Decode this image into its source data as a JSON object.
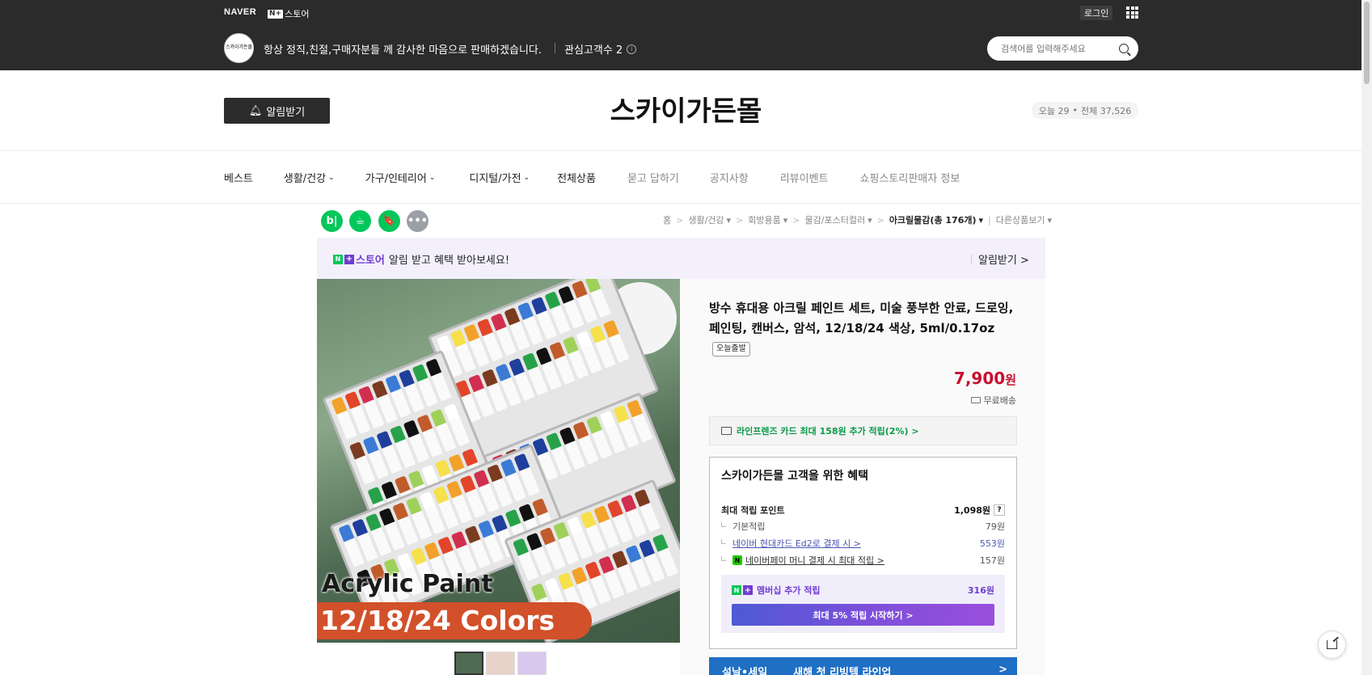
{
  "topbar": {
    "naver_logo": "NAVER",
    "nplus_box": "N+",
    "nplus_store": "스토어",
    "login": "로그인",
    "store_avatar_text": "스카이가든몰",
    "store_description": "항상 정직,친절,구매자분들 께 감사한 마음으로 판매하겠습니다.",
    "interest_label": "관심고객수 2",
    "info_icon": "i",
    "search_placeholder": "검색어를 입력해주세요"
  },
  "header": {
    "alarm_button": "알림받기",
    "store_title": "스카이가든몰",
    "today_visits": "오늘 29",
    "total_visits": "전체 37,526",
    "visit_separator": "•"
  },
  "nav": {
    "items": [
      {
        "label": "베스트",
        "dropdown": ""
      },
      {
        "label": "생활/건강",
        "dropdown": "⌄"
      },
      {
        "label": "가구/인테리어",
        "dropdown": "⌄"
      },
      {
        "label": "디지털/가전",
        "dropdown": "⌄"
      },
      {
        "label": "전체상품",
        "dropdown": ""
      },
      {
        "label": "묻고 답하기",
        "dropdown": ""
      },
      {
        "label": "공지사항",
        "dropdown": ""
      },
      {
        "label": "리뷰이벤트",
        "dropdown": ""
      },
      {
        "label": "쇼핑스토리",
        "dropdown": ""
      },
      {
        "label": "판매자 정보",
        "dropdown": ""
      }
    ]
  },
  "share_buttons": {
    "blog": "b|",
    "cafe": "☕",
    "bookmark": "🔖",
    "more": "•••",
    "colors": [
      "#03c75a",
      "#03c75a",
      "#03c75a",
      "#9aa0a6"
    ]
  },
  "breadcrumb": {
    "items": [
      "홈",
      "생활/건강",
      "회방용품",
      "물감/포스터컬러",
      "아크릴물감(총 176개)",
      "다른상품보기"
    ],
    "sep": ">",
    "dropdown": "▾"
  },
  "banner": {
    "store_label": "스토어",
    "n_badge": "N",
    "plus_badge": "+",
    "message": "알림 받고 혜택 받아보세요!",
    "action": "알림받기 >"
  },
  "product_image": {
    "line1": "Acrylic Paint",
    "line2": "12/18/24 Colors",
    "tube_colors": [
      "#ffffff",
      "#f6e04b",
      "#f2a22a",
      "#e2452a",
      "#d12f4f",
      "#7b3b20",
      "#3b7bd6",
      "#1f3f9c",
      "#27a24a",
      "#111111",
      "#c15b2b",
      "#9fd15a"
    ]
  },
  "product": {
    "title": "방수 휴대용 아크릴 페인트 세트, 미술 풍부한 안료, 드로잉, 페인팅, 캔버스, 암석, 12/18/24 색상, 5ml/0.17oz",
    "today_tag": "오늘출발",
    "price_num": "7,900",
    "price_unit": "원",
    "shipping": "무료배송",
    "card_benefit": "라인프렌즈 카드 최대 158원 추가 적립(2%) >"
  },
  "benefits": {
    "title": "스카이가든몰 고객을 위한 혜택",
    "max_point_label": "최대 적립 포인트",
    "max_point_value": "1,098원",
    "qmark": "?",
    "rows": [
      {
        "label": "기본적립",
        "value": "79원"
      },
      {
        "label": "네이버 현대카드 Ed2로 결제 시 >",
        "value": "553원"
      },
      {
        "label": "네이버페이 머니 결제 시 최대 적립 >",
        "value": "157원"
      }
    ],
    "npay_badge": "N",
    "membership_label": "멤버십 추가 적립",
    "membership_value": "316원",
    "start_button": "최대 5% 적립 시작하기 >"
  },
  "promo": {
    "text1": "설날•세일",
    "text2": "새해 첫 리빙템 라인업",
    "arrow": ">"
  }
}
